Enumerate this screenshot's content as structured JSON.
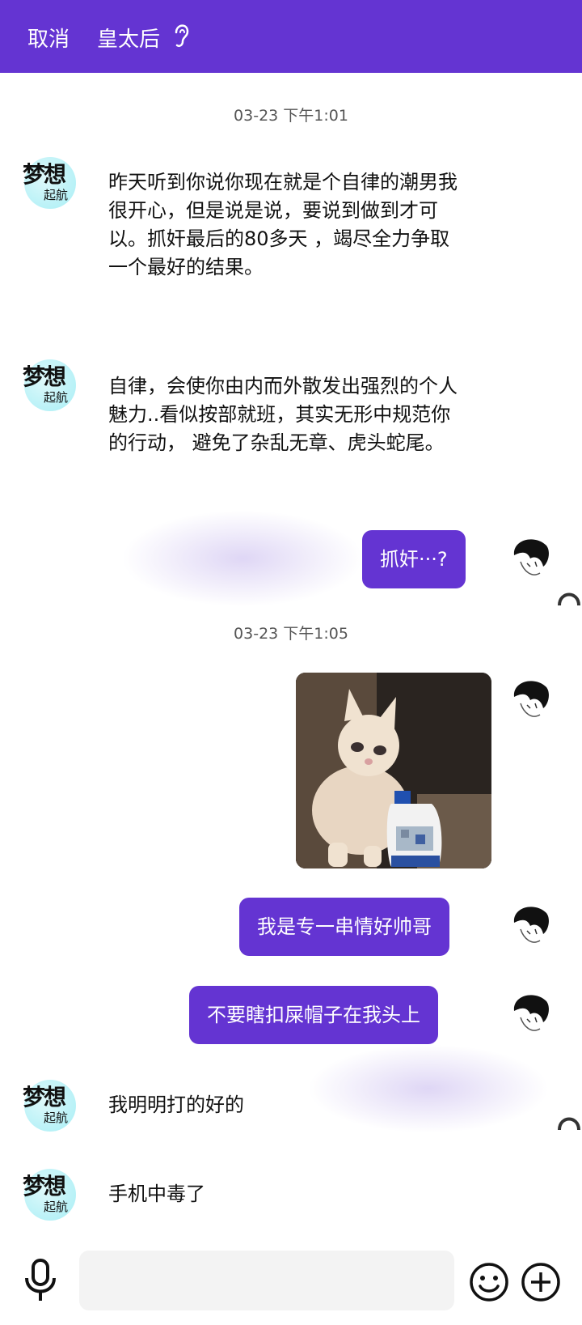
{
  "header": {
    "cancel_label": "取消",
    "title": "皇太后",
    "title_icon": "ear-icon"
  },
  "timestamps": [
    "03-23 下午1:01",
    "03-23 下午1:05"
  ],
  "messages": {
    "m1": "昨天听到你说你现在就是个自律的潮男我很开心，但是说是说，要说到做到才可以。抓奸最后的80多天 ，竭尽全力争取一个最好的结果。",
    "m2": "自律，会使你由内而外散发出强烈的个人魅力..看似按部就班，其实无形中规范你的行动， 避免了杂乱无章、虎头蛇尾。",
    "m3": "抓奸···?",
    "m5": "我是专一串情好帅哥",
    "m6": "不要瞎扣屎帽子在我头上",
    "m7": "我明明打的好的",
    "m8": "手机中毒了"
  },
  "contact_avatar": {
    "line1": "梦想",
    "line2": "起航"
  },
  "colors": {
    "accent": "#6434d2"
  },
  "bottom": {
    "icons": [
      "microphone-icon",
      "emoji-icon",
      "plus-icon"
    ]
  }
}
